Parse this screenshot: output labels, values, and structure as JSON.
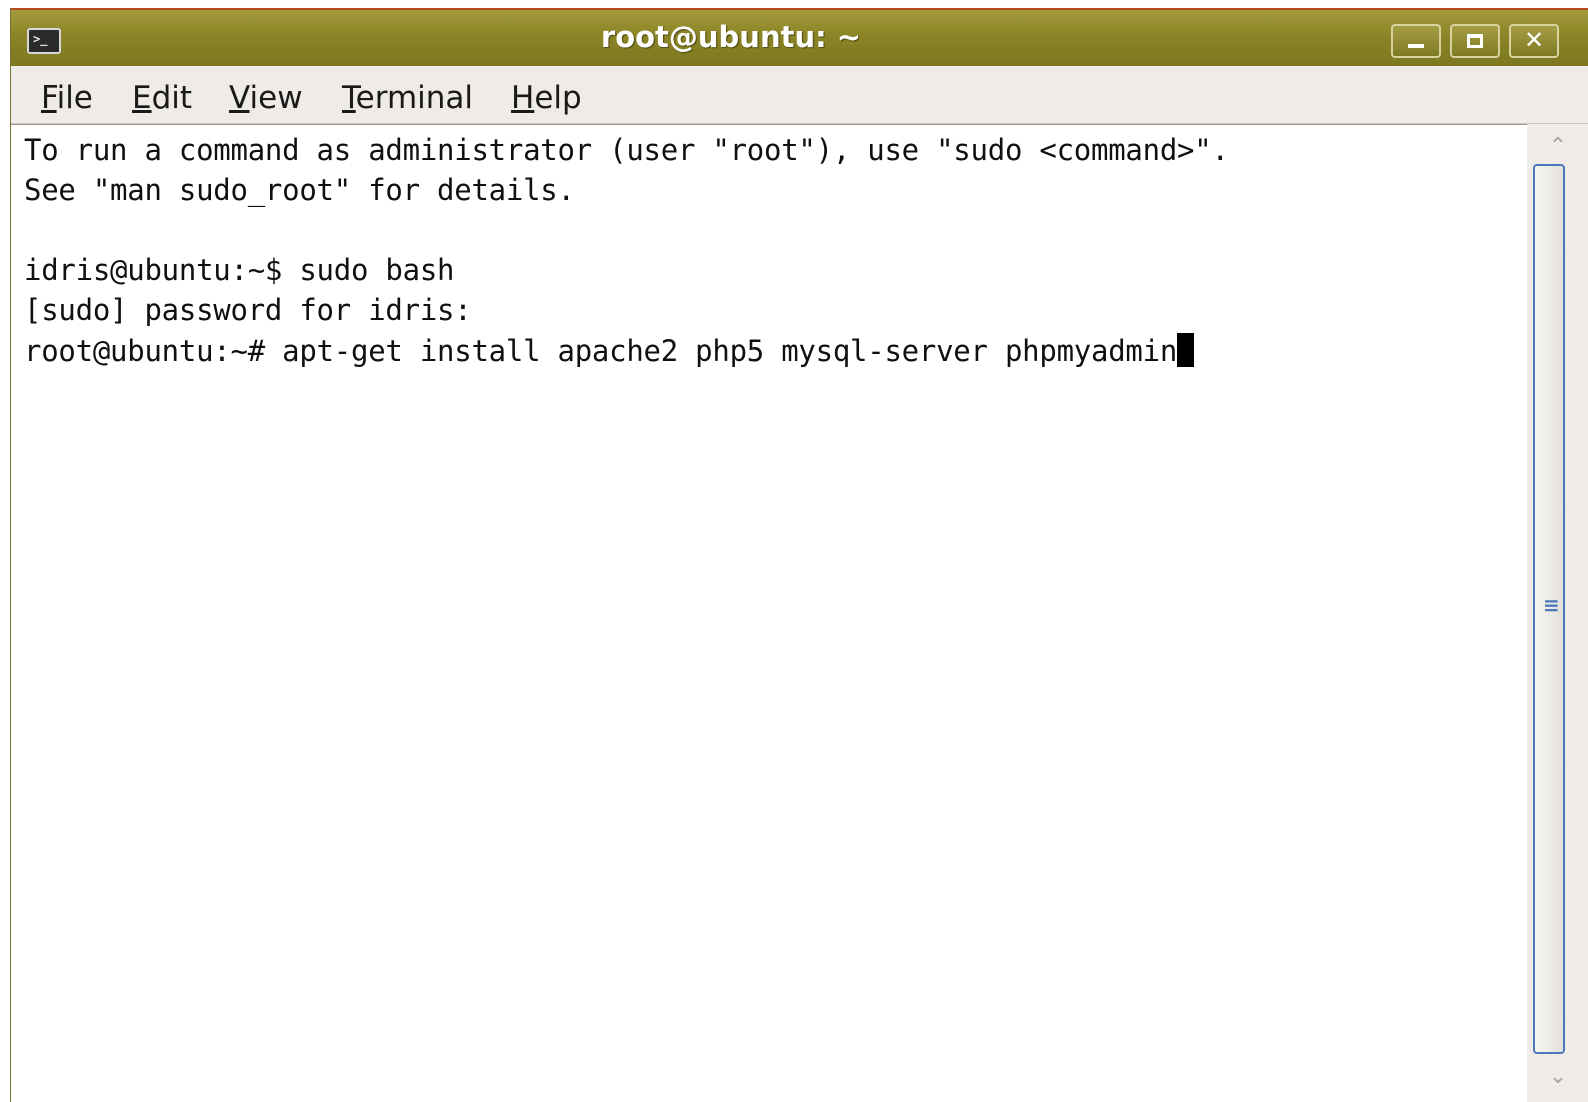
{
  "window": {
    "title": "root@ubuntu: ~"
  },
  "icons": {
    "app": "terminal-icon",
    "minimize": "minimize-icon",
    "maximize": "maximize-icon",
    "close": "close-icon",
    "scroll_up": "chevron-up-icon",
    "scroll_down": "chevron-down-icon"
  },
  "colors": {
    "titlebar": "#8b8526",
    "terminal_background": "#ffffff",
    "terminal_text": "#101010",
    "scrollbar_accent": "#4a78b8"
  },
  "menu": {
    "items": [
      {
        "mnemonic": "F",
        "rest": "ile"
      },
      {
        "mnemonic": "E",
        "rest": "dit"
      },
      {
        "mnemonic": "V",
        "rest": "iew"
      },
      {
        "mnemonic": "T",
        "rest": "erminal"
      },
      {
        "mnemonic": "H",
        "rest": "elp"
      }
    ]
  },
  "terminal": {
    "lines": [
      "To run a command as administrator (user \"root\"), use \"sudo <command>\".",
      "See \"man sudo_root\" for details.",
      "",
      "idris@ubuntu:~$ sudo bash",
      "[sudo] password for idris:",
      "root@ubuntu:~# apt-get install apache2 php5 mysql-server phpmyadmin"
    ]
  },
  "window_buttons": {
    "close_glyph": "✕"
  },
  "scrollbar": {
    "up_glyph": "⌃",
    "down_glyph": "⌄",
    "grip_glyph": "≡"
  }
}
